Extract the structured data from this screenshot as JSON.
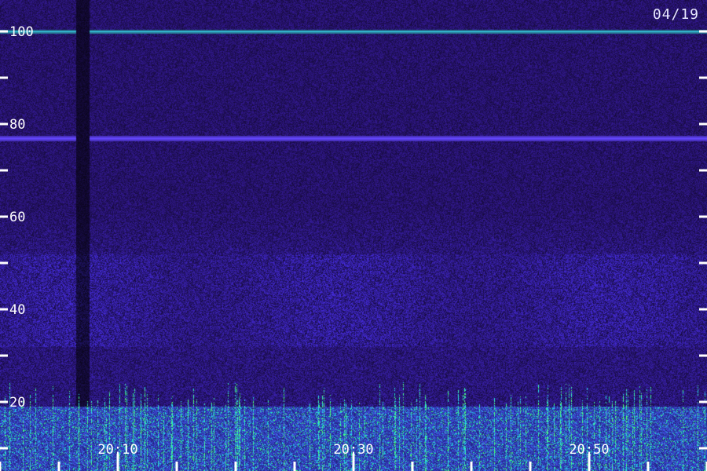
{
  "date_label": "04/19",
  "chart_data": {
    "type": "heatmap",
    "title": "",
    "xlabel": "",
    "ylabel": "",
    "ylim": [
      0,
      102
    ],
    "xlim": [
      "20:05",
      "21:05"
    ],
    "y_ticks": [
      {
        "value": 100,
        "label": "100"
      },
      {
        "value": 80,
        "label": "80"
      },
      {
        "value": 60,
        "label": "60"
      },
      {
        "value": 40,
        "label": "40"
      },
      {
        "value": 20,
        "label": "20"
      }
    ],
    "y_minor_ticks": [
      90,
      70,
      50,
      30,
      10
    ],
    "x_ticks": [
      {
        "value": "20:10",
        "label": "20:10"
      },
      {
        "value": "20:30",
        "label": "20:30"
      },
      {
        "value": "20:50",
        "label": "20:50"
      }
    ],
    "x_minor_tick_step_minutes": 5,
    "colors": {
      "background": "#22105e",
      "noise_dark": "#0c0830",
      "noise_mid": "#2a1a86",
      "noise_bright": "#3a2cd0",
      "strong": "#1fd8c8",
      "peak": "#5cff7a"
    },
    "features": [
      {
        "kind": "carrier",
        "y": 100,
        "intensity": "strong",
        "color": "#2ee8d0"
      },
      {
        "kind": "carrier",
        "y": 77,
        "intensity": "medium",
        "color": "#5a3cff"
      },
      {
        "kind": "band",
        "y_range": [
          32,
          52
        ],
        "intensity": "elevated"
      },
      {
        "kind": "band",
        "y_range": [
          2,
          19
        ],
        "intensity": "strong broadband bursts"
      },
      {
        "kind": "gap",
        "x": "20:07"
      }
    ]
  }
}
